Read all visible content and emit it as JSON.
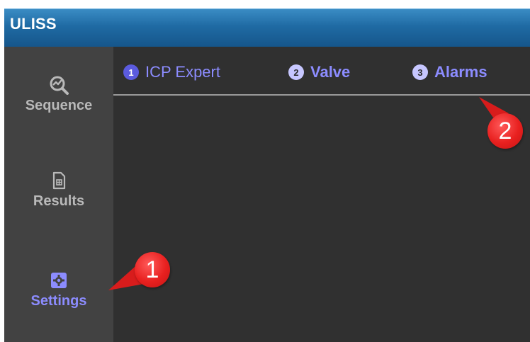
{
  "app": {
    "title": "ULISS"
  },
  "sidebar": {
    "items": [
      {
        "label": "Sequence",
        "icon": "sequence-icon",
        "active": false
      },
      {
        "label": "Results",
        "icon": "document-icon",
        "active": false
      },
      {
        "label": "Settings",
        "icon": "settings-gear-icon",
        "active": true
      }
    ]
  },
  "tabs": [
    {
      "number": "1",
      "label": "ICP Expert",
      "active": true
    },
    {
      "number": "2",
      "label": "Valve",
      "active": false
    },
    {
      "number": "3",
      "label": "Alarms",
      "active": false
    }
  ],
  "callouts": [
    {
      "number": "1"
    },
    {
      "number": "2"
    }
  ],
  "colors": {
    "titlebar": "#1f6aa3",
    "sidebar_bg": "#424242",
    "main_bg": "#303030",
    "accent": "#8c8cff",
    "callout": "#e8201f"
  }
}
